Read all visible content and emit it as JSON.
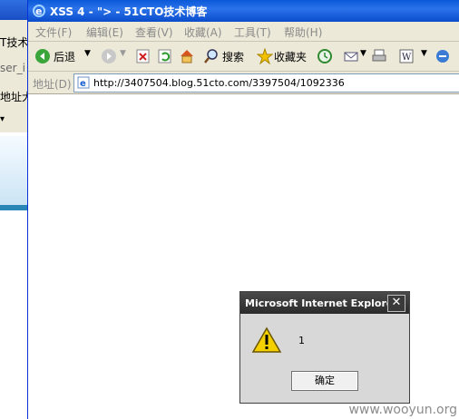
{
  "background_window": {
    "fragments": [
      "T技术",
      "ser_i",
      "地址大"
    ]
  },
  "window": {
    "title": "XSS 4 - \"> - 51CTO技术博客"
  },
  "menu": [
    "文件(F)",
    "编辑(E)",
    "查看(V)",
    "收藏(A)",
    "工具(T)",
    "帮助(H)"
  ],
  "toolbar": {
    "back_label": "后退",
    "search_label": "搜索",
    "favorites_label": "收藏夹"
  },
  "address": {
    "label": "地址(D)",
    "url": "http://3407504.blog.51cto.com/3397504/1092336"
  },
  "dialog": {
    "title": "Microsoft Internet Explorer",
    "message": "1",
    "ok_label": "确定"
  },
  "watermark": "www.wooyun.org"
}
